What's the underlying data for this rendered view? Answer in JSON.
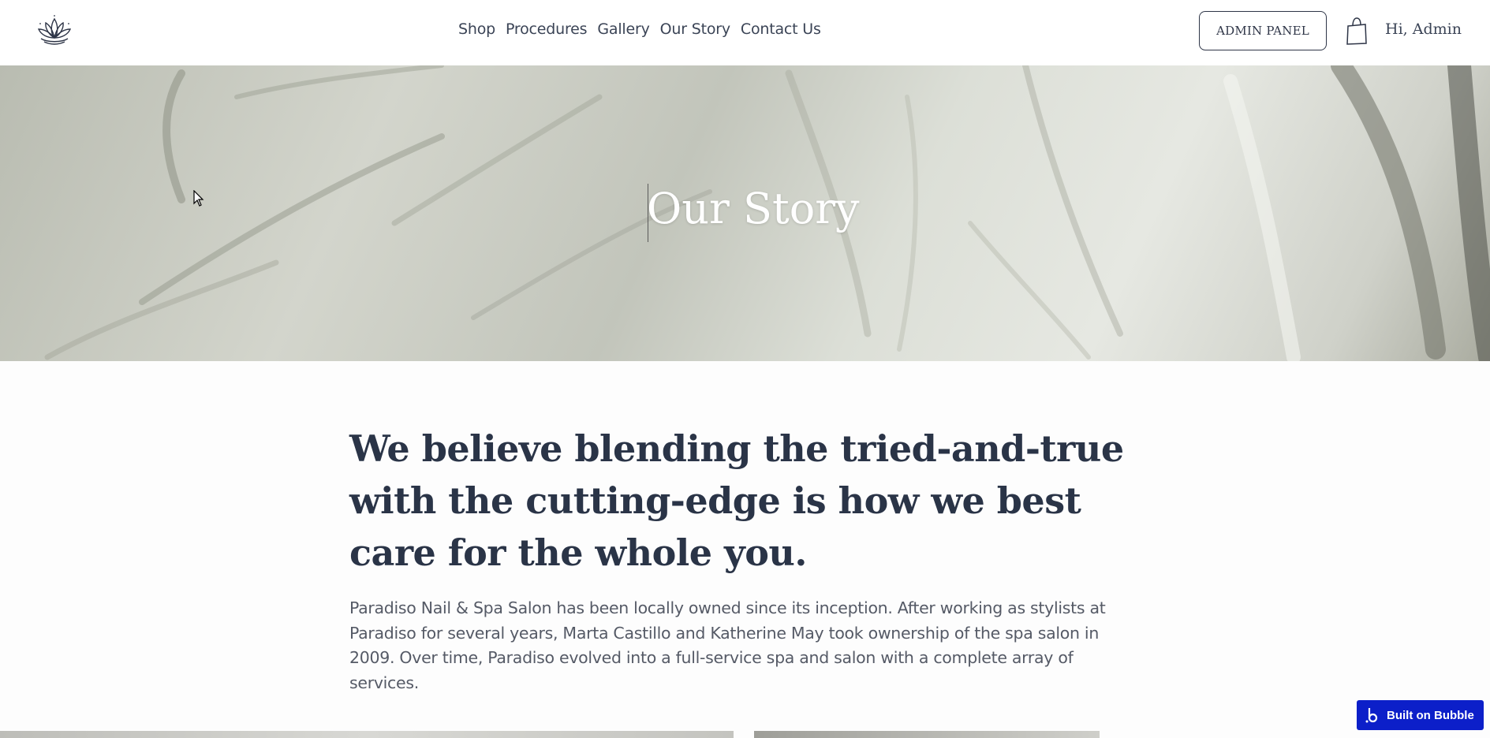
{
  "header": {
    "nav": [
      "Shop",
      "Procedures",
      "Gallery",
      "Our Story",
      "Contact Us"
    ],
    "admin_button": "ADMIN PANEL",
    "greeting": "Hi, Admin"
  },
  "hero": {
    "title": "Our Story"
  },
  "content": {
    "headline": "We believe blending the tried-and-true with the cutting-edge is how we best care for the whole you.",
    "body": "Paradiso Nail & Spa Salon has been locally owned since its inception. After working as stylists at Paradiso for several years, Marta Castillo and Katherine May took ownership of the spa salon in 2009. Over time, Paradiso evolved into a full-service spa and salon with a complete array of services."
  },
  "badge": {
    "label": "Built on Bubble"
  },
  "colors": {
    "text_dark": "#2a3447",
    "badge_blue": "#0c1fc9"
  }
}
